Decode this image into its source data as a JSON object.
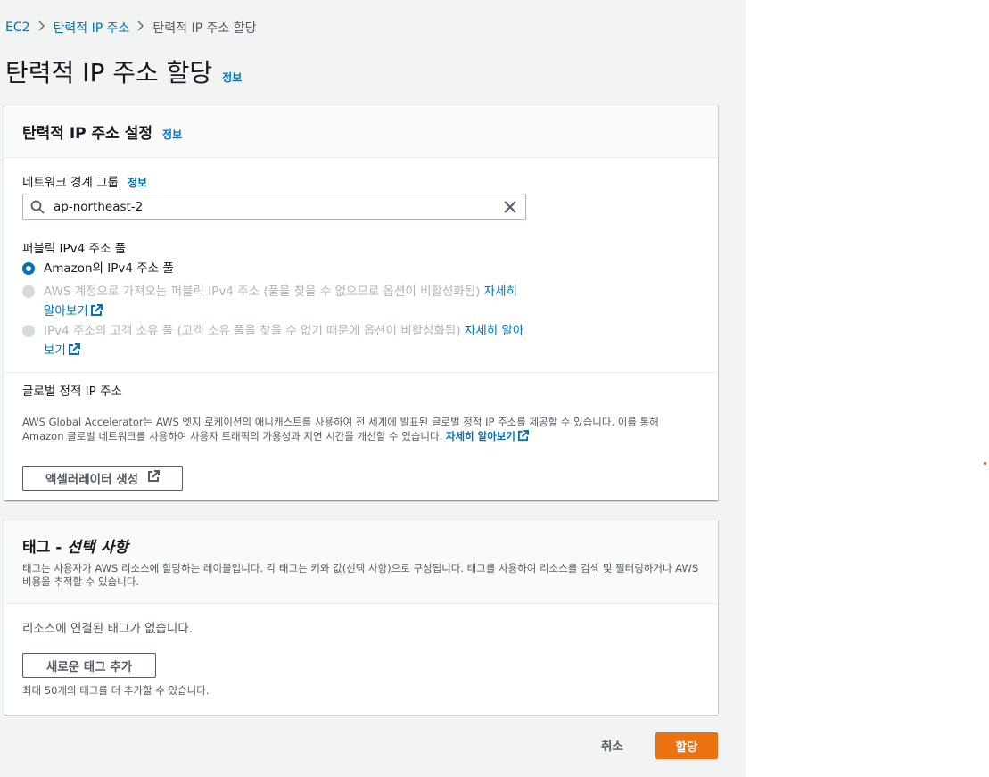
{
  "breadcrumb": {
    "items": [
      "EC2",
      "탄력적 IP 주소"
    ],
    "current": "탄력적 IP 주소 할당"
  },
  "page": {
    "title": "탄력적 IP 주소 할당",
    "info": "정보"
  },
  "settings": {
    "title": "탄력적 IP 주소 설정",
    "info": "정보",
    "network_border_group": {
      "label": "네트워크 경계 그룹",
      "info": "정보",
      "value": "ap-northeast-2"
    },
    "public_pool": {
      "label": "퍼블릭 IPv4 주소 풀",
      "options": [
        {
          "text": "Amazon의 IPv4 주소 풀",
          "selected": true,
          "disabled": false
        },
        {
          "text": "AWS 계정으로 가져오는 퍼블릭 IPv4 주소 (풀을 찾을 수 없으므로 옵션이 비활성화됨)",
          "link": "자세히 알아보기",
          "selected": false,
          "disabled": true
        },
        {
          "text": "IPv4 주소의 고객 소유 풀 (고객 소유 풀을 찾을 수 없기 때문에 옵션이 비활성화됨)",
          "link": "자세히 알아보기",
          "selected": false,
          "disabled": true
        }
      ]
    },
    "global_static": {
      "label": "글로벌 정적 IP 주소",
      "description": "AWS Global Accelerator는 AWS 엣지 로케이션의 애니캐스트를 사용하여 전 세계에 발표된 글로벌 정적 IP 주소를 제공할 수 있습니다. 이를 통해 Amazon 글로벌 네트워크를 사용하여 사용자 트래픽의 가용성과 지연 시간을 개선할 수 있습니다.",
      "link": "자세히 알아보기",
      "button": "액셀러레이터 생성"
    }
  },
  "tags": {
    "title": "태그 -",
    "title_optional": "선택 사항",
    "description": "태그는 사용자가 AWS 리소스에 할당하는 레이블입니다. 각 태그는 키와 값(선택 사항)으로 구성됩니다. 태그를 사용하여 리소스를 검색 및 필터링하거나 AWS 비용을 추적할 수 있습니다.",
    "empty": "리소스에 연결된 태그가 없습니다.",
    "add_button": "새로운 태그 추가",
    "limit_hint": "최대 50개의 태그를 더 추가할 수 있습니다."
  },
  "footer": {
    "cancel": "취소",
    "submit": "할당"
  },
  "colors": {
    "link": "#0073bb",
    "primary": "#ec7211",
    "background": "#f2f3f3"
  }
}
